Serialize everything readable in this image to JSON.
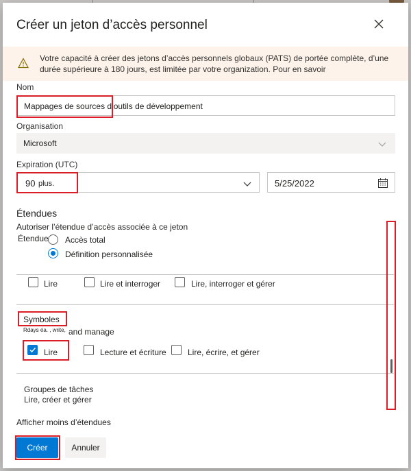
{
  "dialog": {
    "title": "Créer un jeton d’accès personnel",
    "close_icon": "close-icon"
  },
  "warning": {
    "icon": "warning-icon",
    "text": "Votre capacité à créer des jetons d’accès personnels globaux (PATS) de portée complète, d’une durée supérieure à 180 jours, est limitée par votre organization. Pour en savoir"
  },
  "name": {
    "label": "Nom",
    "value": "Mappages de sources d’outils de développement"
  },
  "organization": {
    "label": "Organisation",
    "value": "Microsoft"
  },
  "expiration": {
    "label": "Expiration (UTC)",
    "value": "90",
    "suffix": "plus.",
    "date": "5/25/2022"
  },
  "scopes": {
    "title": "Étendues",
    "description": "Autoriser l’étendue d’accès associée à ce jeton",
    "sub_label": "Étendues",
    "options": [
      {
        "label": "Accès total",
        "selected": false
      },
      {
        "label": "Définition personnalisée",
        "selected": true
      }
    ],
    "top_row": [
      {
        "label": "Lire",
        "checked": false
      },
      {
        "label": "Lire et interroger",
        "checked": false
      },
      {
        "label": "Lire, interroger et gérer",
        "checked": false
      }
    ],
    "symbols": {
      "title": "Symboles",
      "desc_small": "Rdays éa. , write,",
      "desc_tail": "and manage",
      "options": [
        {
          "label": "Lire",
          "checked": true
        },
        {
          "label": "Lecture et écriture",
          "checked": false
        },
        {
          "label": "Lire, écrire, et gérer",
          "checked": false
        }
      ]
    },
    "task_groups": {
      "title": "Groupes de tâches",
      "desc": "Lire, créer et gérer"
    },
    "show_less": "Afficher moins d’étendues"
  },
  "actions": {
    "create": "Créer",
    "cancel": "Annuler"
  },
  "colors": {
    "accent": "#0078d4",
    "highlight": "#d91c25",
    "warning_bg": "#fdf3ea"
  }
}
